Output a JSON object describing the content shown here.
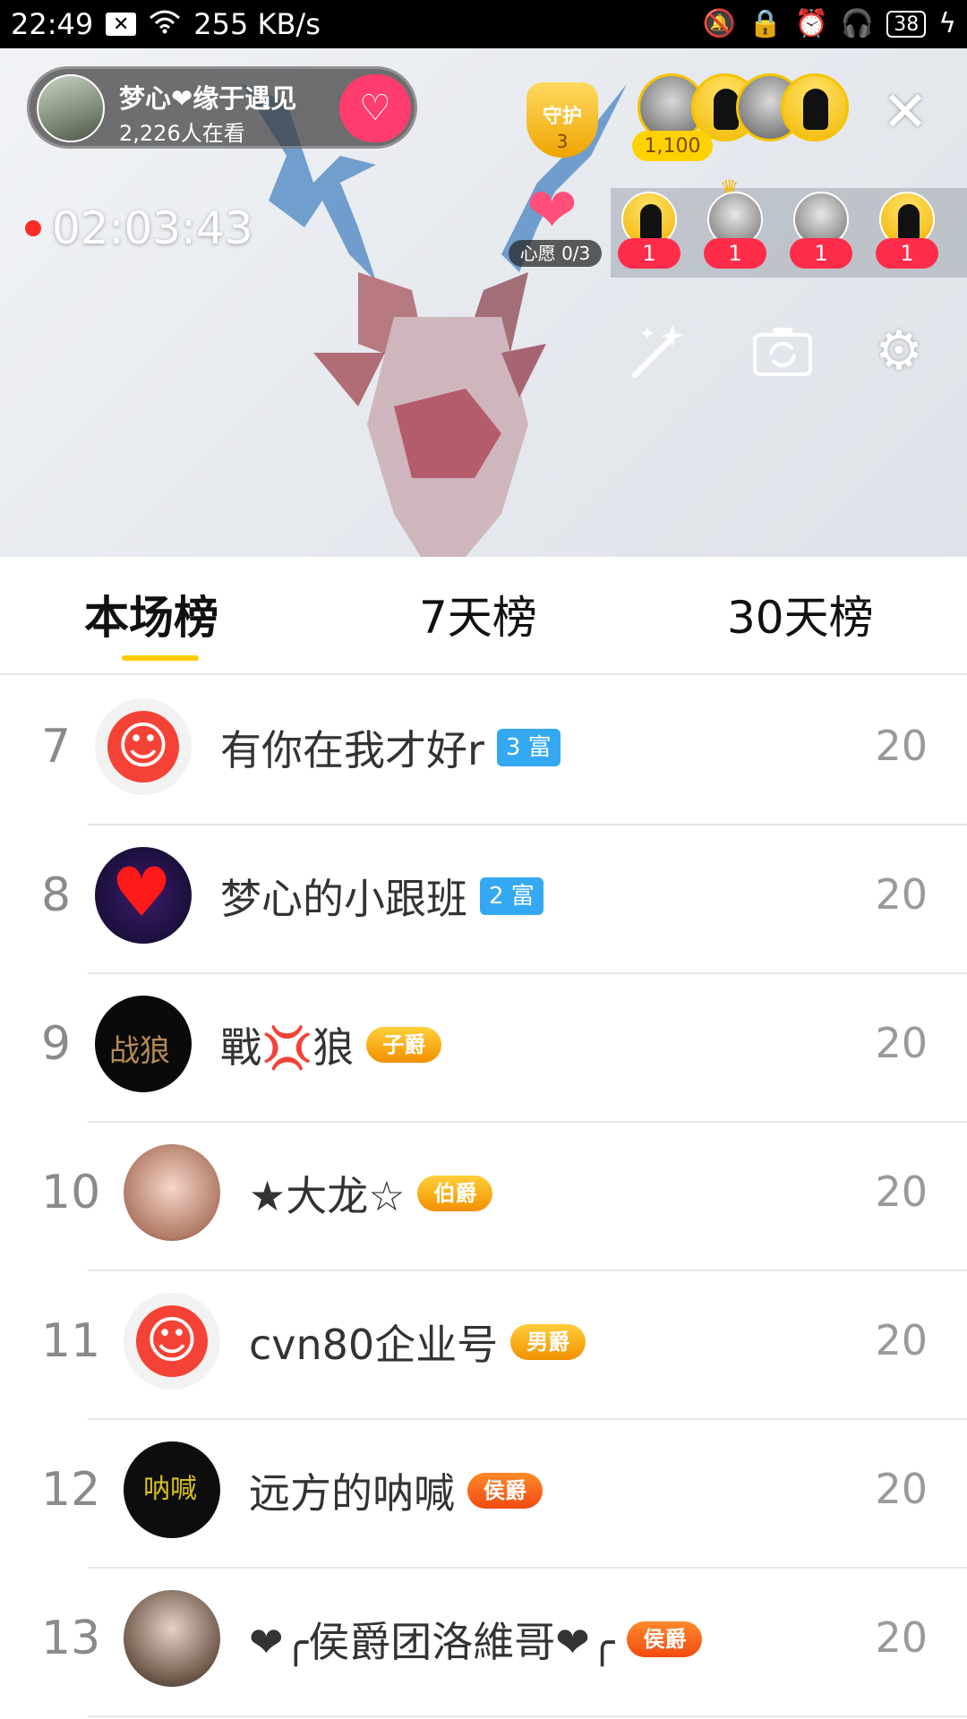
{
  "status_bar": {
    "time": "22:49",
    "network_speed": "255 KB/s",
    "battery": "38",
    "icons": [
      "close-box-icon",
      "wifi-icon",
      "mute-icon",
      "lock-icon",
      "alarm-icon",
      "headset-icon",
      "charging-icon"
    ]
  },
  "stream": {
    "host_name": "梦心❤缘于遇见",
    "viewers": "2,226人在看",
    "guard_label": "守护",
    "guard_count": "3",
    "top_viewer_score": "1,100",
    "recording_time": "02:03:43",
    "wish_label": "心愿 0/3",
    "fan_counts": [
      "1",
      "1",
      "1",
      "1"
    ]
  },
  "tabs": [
    {
      "label": "本场榜",
      "active": true
    },
    {
      "label": "7天榜",
      "active": false
    },
    {
      "label": "30天榜",
      "active": false
    }
  ],
  "ranking": [
    {
      "rank": "7",
      "name": "有你在我才好r",
      "badge": "3 富",
      "badge_type": "blue",
      "score": "20",
      "avatar": "logo"
    },
    {
      "rank": "8",
      "name": "梦心的小跟班",
      "badge": "2 富",
      "badge_type": "blue",
      "score": "20",
      "avatar": "hearts"
    },
    {
      "rank": "9",
      "name": "戰💢狼",
      "badge": "子爵",
      "badge_type": "gold",
      "score": "20",
      "avatar": "dark"
    },
    {
      "rank": "10",
      "name": "★大龙☆",
      "badge": "伯爵",
      "badge_type": "gold",
      "score": "20",
      "avatar": "face"
    },
    {
      "rank": "11",
      "name": "cvn80企业号",
      "badge": "男爵",
      "badge_type": "gold",
      "score": "20",
      "avatar": "logo"
    },
    {
      "rank": "12",
      "name": "远方的呐喊",
      "badge": "侯爵",
      "badge_type": "red",
      "score": "20",
      "avatar": "knight"
    },
    {
      "rank": "13",
      "name": "❤╭侯爵团洛維哥❤╭",
      "badge": "侯爵",
      "badge_type": "red",
      "score": "20",
      "avatar": "portrait"
    }
  ]
}
